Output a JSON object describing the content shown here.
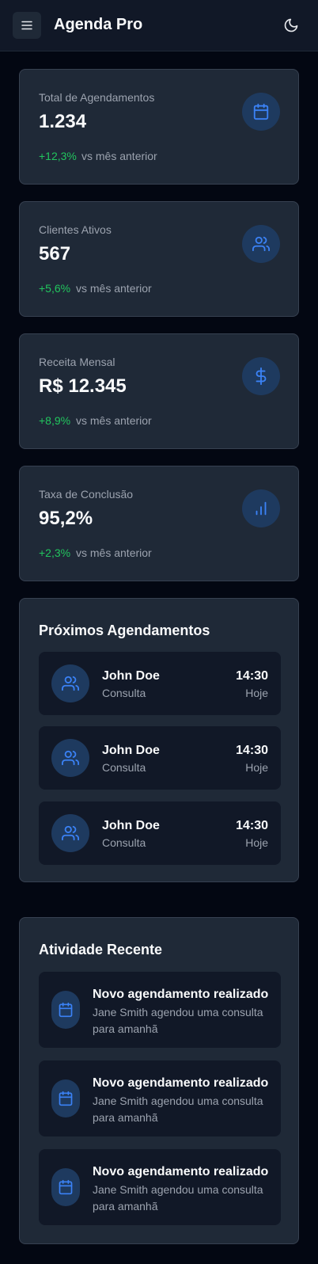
{
  "header": {
    "app_title": "Agenda Pro",
    "menu_icon": "menu-icon",
    "theme_icon": "moon-icon"
  },
  "stats": [
    {
      "label": "Total de Agendamentos",
      "value": "1.234",
      "change": "+12,3%",
      "compare": "vs mês anterior",
      "icon": "calendar-icon"
    },
    {
      "label": "Clientes Ativos",
      "value": "567",
      "change": "+5,6%",
      "compare": "vs mês anterior",
      "icon": "users-icon"
    },
    {
      "label": "Receita Mensal",
      "value": "R$ 12.345",
      "change": "+8,9%",
      "compare": "vs mês anterior",
      "icon": "dollar-icon"
    },
    {
      "label": "Taxa de Conclusão",
      "value": "95,2%",
      "change": "+2,3%",
      "compare": "vs mês anterior",
      "icon": "bar-chart-icon"
    }
  ],
  "upcoming": {
    "title": "Próximos Agendamentos",
    "items": [
      {
        "name": "John Doe",
        "type": "Consulta",
        "time": "14:30",
        "day": "Hoje"
      },
      {
        "name": "John Doe",
        "type": "Consulta",
        "time": "14:30",
        "day": "Hoje"
      },
      {
        "name": "John Doe",
        "type": "Consulta",
        "time": "14:30",
        "day": "Hoje"
      }
    ]
  },
  "recent": {
    "title": "Atividade Recente",
    "items": [
      {
        "title": "Novo agendamento realizado",
        "description": "Jane Smith agendou uma consulta para amanhã"
      },
      {
        "title": "Novo agendamento realizado",
        "description": "Jane Smith agendou uma consulta para amanhã"
      },
      {
        "title": "Novo agendamento realizado",
        "description": "Jane Smith agendou uma consulta para amanhã"
      }
    ]
  },
  "colors": {
    "background": "#030712",
    "card": "#1f2937",
    "accent": "#3b82f6",
    "positive": "#22c55e"
  }
}
